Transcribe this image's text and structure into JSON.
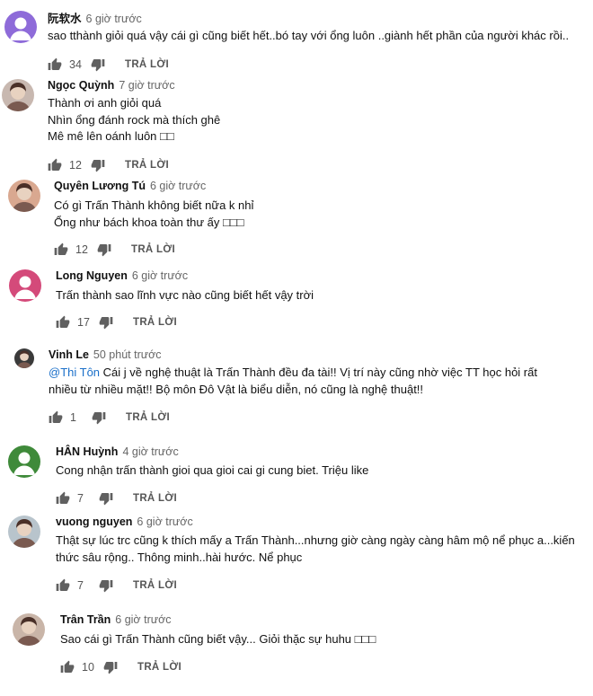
{
  "comments": [
    {
      "author": "阮软水",
      "time": "6 giờ trước",
      "lines": [
        "sao tthành giỏi quá vậy cái gì cũng biết hết..bó tay với ổng luôn ..giành hết phần của người khác rồi.."
      ],
      "likes": "34",
      "reply_label": "TRẢ LỜI",
      "avatar": {
        "kind": "placeholder",
        "color": "#8e6bd9"
      }
    },
    {
      "author": "Ngọc Quỳnh",
      "time": "7 giờ trước",
      "lines": [
        "Thành ơi anh giỏi quá",
        "Nhìn ổng đánh rock mà thích ghê",
        "Mê mê lên oánh luôn □□"
      ],
      "likes": "12",
      "reply_label": "TRẢ LỜI",
      "avatar": {
        "kind": "photo",
        "color": "#c8b8b0"
      }
    },
    {
      "author": "Quyên Lương Tú",
      "time": "6 giờ trước",
      "lines": [
        "Có gì Trấn Thành không biết nữa k nhỉ",
        "Ổng như bách khoa toàn thư ấy □□□"
      ],
      "likes": "12",
      "reply_label": "TRẢ LỜI",
      "avatar": {
        "kind": "photo",
        "color": "#d9a890"
      }
    },
    {
      "author": "Long Nguyen",
      "time": "6 giờ trước",
      "lines": [
        "Trấn thành sao lĩnh vực nào cũng biết hết vậy trời"
      ],
      "likes": "17",
      "reply_label": "TRẢ LỜI",
      "avatar": {
        "kind": "placeholder",
        "color": "#d44a7a"
      }
    },
    {
      "author": "Vinh Le",
      "time": "50 phút trước",
      "mention": "@Thi Tôn",
      "lines": [
        " Cái j về nghệ thuật là Trấn Thành đều đa tài!! Vị trí này cũng nhờ việc TT học hỏi rất",
        "nhiều từ nhiều mặt!! Bộ môn Đô Vật là biểu diễn, nó cũng là nghệ thuật!!"
      ],
      "likes": "1",
      "reply_label": "TRẢ LỜI",
      "avatar": {
        "kind": "photo",
        "color": "#3a3a3a"
      }
    },
    {
      "author": "HÂN Huỳnh",
      "time": "4 giờ trước",
      "lines": [
        "Cong nhận trấn thành gioi qua gioi cai gi cung biet. Triệu like"
      ],
      "likes": "7",
      "reply_label": "TRẢ LỜI",
      "avatar": {
        "kind": "placeholder",
        "color": "#3f8a3a"
      }
    },
    {
      "author": "vuong nguyen",
      "time": "6 giờ trước",
      "lines": [
        "Thật sự lúc trc cũng k thích mấy a Trấn Thành...nhưng giờ càng ngày càng hâm mộ nể phục a...kiến",
        "thức sâu rộng.. Thông minh..hài hước. Nể phục"
      ],
      "likes": "7",
      "reply_label": "TRẢ LỜI",
      "avatar": {
        "kind": "photo",
        "color": "#b8c4cc"
      }
    },
    {
      "author": "Trân Trần",
      "time": "6 giờ trước",
      "lines": [
        "Sao cái gì Trấn Thành cũng biết vậy... Giỏi thặc sự huhu □□□"
      ],
      "likes": "10",
      "reply_label": "TRẢ LỜI",
      "avatar": {
        "kind": "photo",
        "color": "#c9b5a8"
      }
    }
  ]
}
